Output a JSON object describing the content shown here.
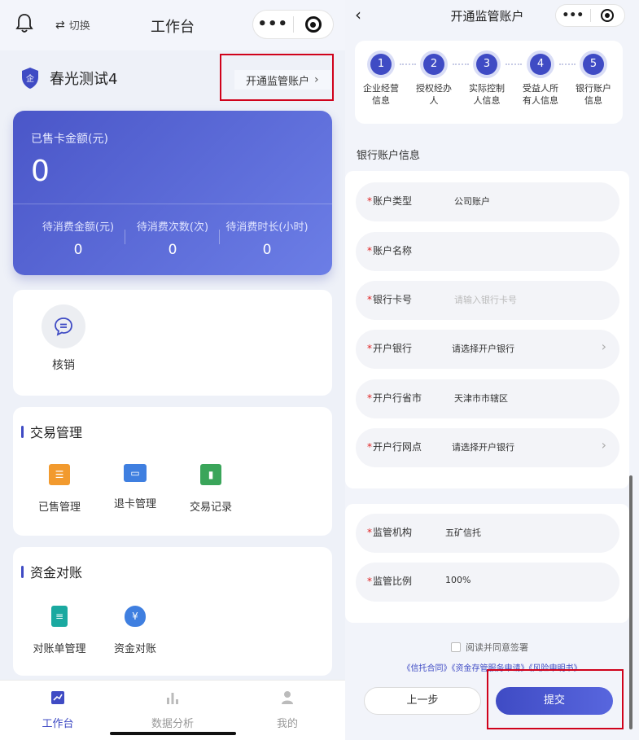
{
  "left": {
    "nav": {
      "title": "工作台",
      "switch_label": "切换"
    },
    "company": {
      "name": "春光测试4"
    },
    "open_account_link": "开通监管账户",
    "stats": {
      "sold_label": "已售卡金额(元)",
      "sold_value": "0",
      "columns": [
        {
          "label": "待消费金额(元)",
          "value": "0"
        },
        {
          "label": "待消费次数(次)",
          "value": "0"
        },
        {
          "label": "待消费时长(小时)",
          "value": "0"
        }
      ]
    },
    "verify": {
      "label": "核销"
    },
    "trade_section": {
      "title": "交易管理",
      "items": [
        {
          "label": "已售管理",
          "icon": "list-icon"
        },
        {
          "label": "退卡管理",
          "icon": "card-icon"
        },
        {
          "label": "交易记录",
          "icon": "notepad-chart-icon"
        }
      ]
    },
    "fund_section": {
      "title": "资金对账",
      "items": [
        {
          "label": "对账单管理",
          "icon": "statement-icon"
        },
        {
          "label": "资金对账",
          "icon": "money-bag-icon"
        }
      ]
    },
    "tabbar": [
      {
        "label": "工作台",
        "active": true
      },
      {
        "label": "数据分析",
        "active": false
      },
      {
        "label": "我的",
        "active": false
      }
    ]
  },
  "right": {
    "nav": {
      "title": "开通监管账户"
    },
    "steps": [
      {
        "num": "1",
        "line1": "企业经营",
        "line2": "信息"
      },
      {
        "num": "2",
        "line1": "授权经办",
        "line2": "人"
      },
      {
        "num": "3",
        "line1": "实际控制",
        "line2": "人信息"
      },
      {
        "num": "4",
        "line1": "受益人所",
        "line2": "有人信息"
      },
      {
        "num": "5",
        "line1": "银行账户",
        "line2": "信息"
      }
    ],
    "section_title": "银行账户信息",
    "bank_rows": [
      {
        "label": "账户类型",
        "value": "公司账户",
        "placeholder": false,
        "chevron": false
      },
      {
        "label": "账户名称",
        "value": "",
        "placeholder": false,
        "chevron": false
      },
      {
        "label": "银行卡号",
        "value": "请输入银行卡号",
        "placeholder": true,
        "chevron": false
      },
      {
        "label": "开户银行",
        "value": "请选择开户银行",
        "placeholder": false,
        "chevron": true
      },
      {
        "label": "开户行省市",
        "value": "天津市市辖区",
        "placeholder": false,
        "chevron": false
      },
      {
        "label": "开户行网点",
        "value": "请选择开户银行",
        "placeholder": false,
        "chevron": true
      }
    ],
    "supervision_rows": [
      {
        "label": "监管机构",
        "value": "五矿信托"
      },
      {
        "label": "监管比例",
        "value": "100%"
      }
    ],
    "agree_text": "阅读并同意签署",
    "contracts": "《信托合同》《资金存管服务申请》《风险申明书》",
    "prev_button": "上一步",
    "submit_button": "提交"
  },
  "colors": {
    "primary": "#3f4bc4",
    "highlight": "#d0021b",
    "required": "#e02020"
  }
}
